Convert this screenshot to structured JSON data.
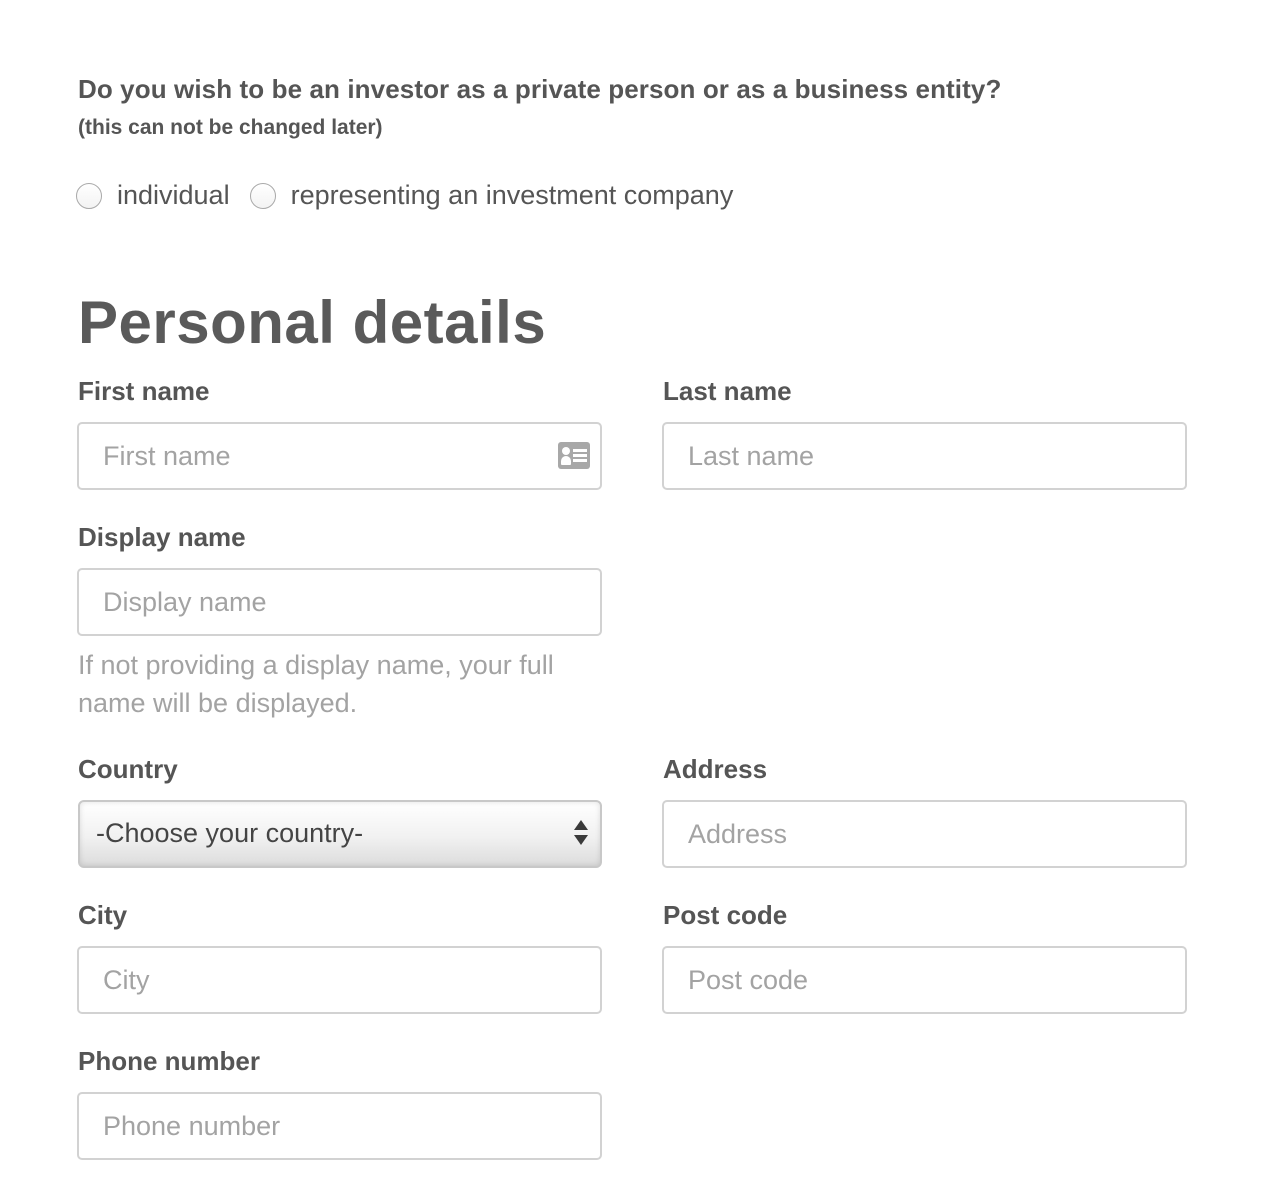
{
  "investor_type": {
    "question": "Do you wish to be an investor as a private person or as a business entity?",
    "note": "(this can not be changed later)",
    "options": [
      {
        "label": "individual",
        "selected": false
      },
      {
        "label": "representing an investment company",
        "selected": false
      }
    ]
  },
  "personal_details": {
    "title": "Personal details",
    "first_name": {
      "label": "First name",
      "placeholder": "First name",
      "value": ""
    },
    "last_name": {
      "label": "Last name",
      "placeholder": "Last name",
      "value": ""
    },
    "display_name": {
      "label": "Display name",
      "placeholder": "Display name",
      "value": "",
      "help": "If not providing a display name, your full name will be displayed."
    },
    "country": {
      "label": "Country",
      "selected": "-Choose your country-"
    },
    "address": {
      "label": "Address",
      "placeholder": "Address",
      "value": ""
    },
    "city": {
      "label": "City",
      "placeholder": "City",
      "value": ""
    },
    "post_code": {
      "label": "Post code",
      "placeholder": "Post code",
      "value": ""
    },
    "phone_number": {
      "label": "Phone number",
      "placeholder": "Phone number",
      "value": ""
    }
  },
  "icons": {
    "first_name_autofill": "contact-card-icon",
    "country_select": "select-arrows-icon"
  },
  "colors": {
    "text": "#555555",
    "placeholder": "#a3a3a3",
    "border": "#d2d2d2"
  }
}
